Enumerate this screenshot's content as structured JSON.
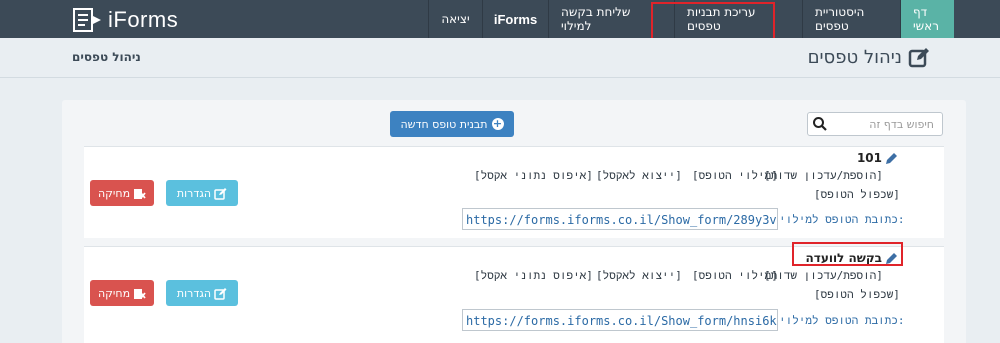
{
  "brand": {
    "name": "iForms"
  },
  "nav": {
    "home": "דף ראשי",
    "history": "היסטוריית טפסים",
    "edit_templates": "עריכת תבניות טפסים",
    "send_request": "שליחת בקשה למילוי",
    "iforms": "iForms",
    "logout": "יציאה"
  },
  "page": {
    "title": "ניהול טפסים",
    "breadcrumb": "ניהול טפסים"
  },
  "toolbar": {
    "new_template": "תבנית טופס חדשה",
    "search_placeholder": "חיפוש בדף זה"
  },
  "forms": [
    {
      "title": "101",
      "add_fields": "[הוספת/עדכון שדות]",
      "fill": "[מילוי הטופס]",
      "export": "[ייצוא לאקסל]",
      "reset": "[איפוס נתוני אקסל]",
      "duplicate": "[שכפול הטופס]",
      "url_label": "כתובת הטופס למילוי:",
      "url": "https://forms.iforms.co.il/Show_form/289y3v68gt",
      "settings": "הגדרות",
      "delete": "מחיקה"
    },
    {
      "title": "בקשה לוועדה",
      "add_fields": "[הוספת/עדכון שדות]",
      "fill": "[מילוי הטופס]",
      "export": "[ייצוא לאקסל]",
      "reset": "[איפוס נתוני אקסל]",
      "duplicate": "[שכפול הטופס]",
      "url_label": "כתובת הטופס למילוי:",
      "url": "https://forms.iforms.co.il/Show_form/hnsi6k65ou",
      "settings": "הגדרות",
      "delete": "מחיקה"
    }
  ],
  "colors": {
    "navbar": "#3c4a57",
    "active_tab": "#5ab3a6",
    "primary": "#3d82c1",
    "info": "#5bc0de",
    "danger": "#d9534f",
    "highlight": "#e0242a"
  }
}
